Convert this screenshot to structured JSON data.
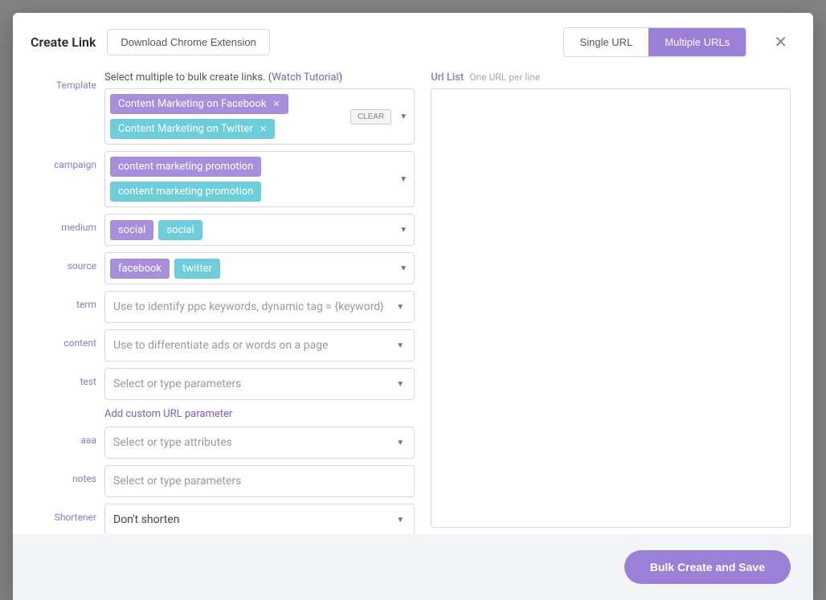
{
  "header": {
    "title": "Create Link",
    "download_ext": "Download Chrome Extension",
    "toggle_single": "Single URL",
    "toggle_multiple": "Multiple URLs"
  },
  "intro": {
    "text_prefix": "Select multiple to bulk create links. (",
    "tutorial_link": "Watch Tutorial",
    "text_suffix": ")"
  },
  "labels": {
    "template": "Template",
    "campaign": "campaign",
    "medium": "medium",
    "source": "source",
    "term": "term",
    "content": "content",
    "test": "test",
    "aaa": "aaa",
    "notes": "notes",
    "shortener": "Shortener"
  },
  "template_tags": [
    {
      "text": "Content Marketing on Facebook",
      "color": "purple"
    },
    {
      "text": "Content Marketing on Twitter",
      "color": "teal"
    }
  ],
  "clear_label": "CLEAR",
  "campaign_tags": [
    {
      "text": "content marketing promotion",
      "color": "purple"
    },
    {
      "text": "content marketing promotion",
      "color": "teal"
    }
  ],
  "medium_tags": [
    {
      "text": "social",
      "color": "purple"
    },
    {
      "text": "social",
      "color": "teal"
    }
  ],
  "source_tags": [
    {
      "text": "facebook",
      "color": "purple"
    },
    {
      "text": "twitter",
      "color": "teal"
    }
  ],
  "placeholders": {
    "term": "Use to identify ppc keywords, dynamic tag = {keyword}",
    "content": "Use to differentiate ads or words on a page",
    "test": "Select or type parameters",
    "aaa": "Select or type attributes",
    "notes": "Select or type parameters"
  },
  "add_param": "Add custom URL parameter",
  "shortener_value": "Don't shorten",
  "url_list": {
    "title": "Url List",
    "subtitle": "One URL per line"
  },
  "footer": {
    "primary": "Bulk Create and Save"
  }
}
